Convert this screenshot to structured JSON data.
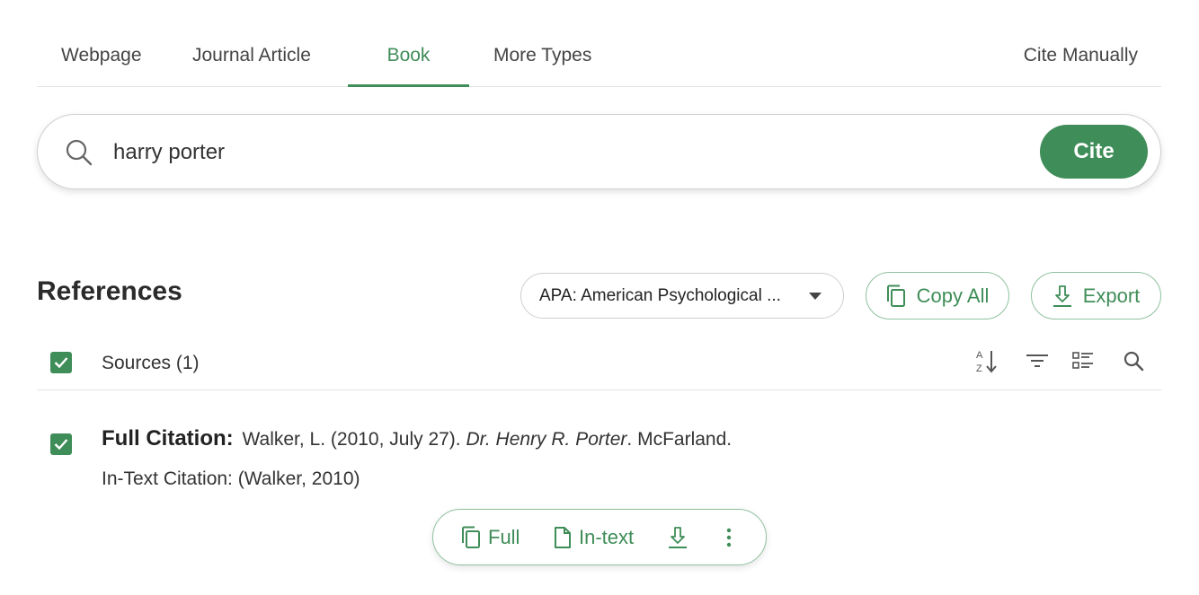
{
  "tabs": [
    {
      "label": "Webpage",
      "active": false
    },
    {
      "label": "Journal Article",
      "active": false
    },
    {
      "label": "Book",
      "active": true
    },
    {
      "label": "More Types",
      "active": false
    }
  ],
  "cite_manually_label": "Cite Manually",
  "search": {
    "value": "harry porter",
    "cite_label": "Cite"
  },
  "references": {
    "title": "References",
    "style_selected": "APA: American Psychological ...",
    "copy_all_label": "Copy All",
    "export_label": "Export"
  },
  "sources": {
    "label": "Sources (1)",
    "checked": true
  },
  "citation": {
    "full_label": "Full Citation:",
    "full_prefix": " Walker, L. (2010, July 27). ",
    "full_title": "Dr. Henry R. Porter",
    "full_suffix": ". McFarland.",
    "in_text": "In-Text Citation: (Walker, 2010)",
    "checked": true
  },
  "actions": {
    "full_label": "Full",
    "intext_label": "In-text"
  },
  "colors": {
    "accent": "#3f8d58",
    "accent_border": "#8fc19f",
    "text": "#333333",
    "divider": "#e3e3e3"
  },
  "icons": [
    "search-icon",
    "copy-icon",
    "download-icon",
    "sort-az-icon",
    "filter-icon",
    "list-view-icon",
    "document-icon",
    "more-vertical-icon",
    "checkmark-icon",
    "caret-down-icon"
  ]
}
